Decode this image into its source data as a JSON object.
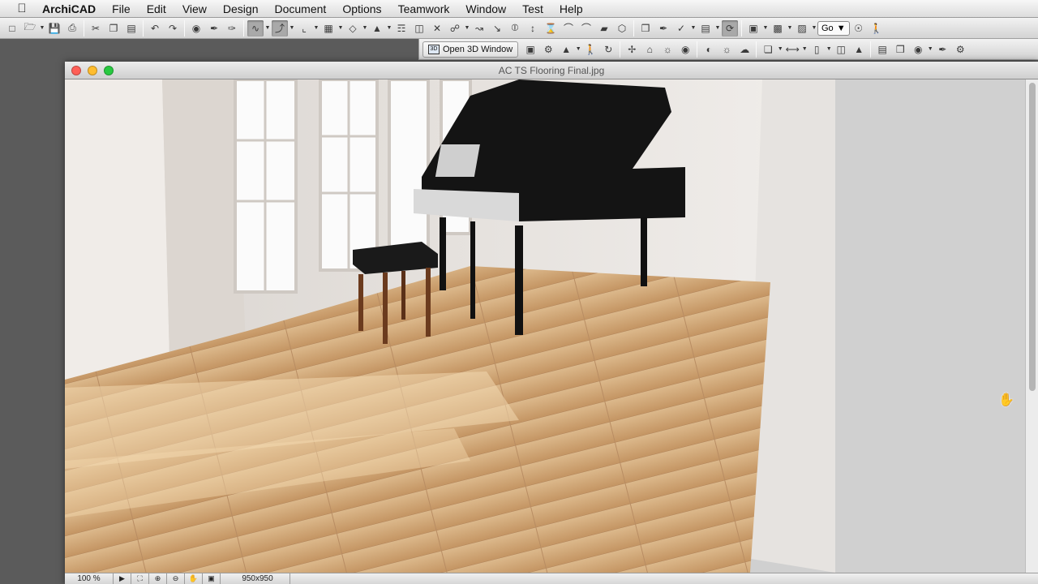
{
  "menubar": {
    "app_name": "ArchiCAD",
    "items": [
      "File",
      "Edit",
      "View",
      "Design",
      "Document",
      "Options",
      "Teamwork",
      "Window",
      "Test",
      "Help"
    ]
  },
  "toolbar2": {
    "open3d_label": "Open 3D Window"
  },
  "toolbar1": {
    "go_label": "Go"
  },
  "window": {
    "title": "AC TS Flooring Final.jpg",
    "zoom": "100 %",
    "image_size": "950x950"
  },
  "colors": {
    "floor": "#c9a06e",
    "wall": "#ece8e4",
    "piano": "#141414"
  }
}
